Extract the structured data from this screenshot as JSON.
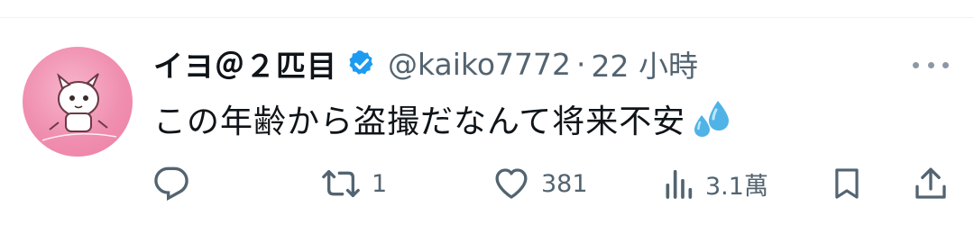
{
  "tweet": {
    "display_name": "イヨ＠２匹目",
    "handle": "@kaiko7772",
    "separator": "·",
    "time": "22 小時",
    "text": "この年齢から盗撮だなんて将来不安",
    "emoji": "sweat-droplets-icon"
  },
  "actions": {
    "reply": {
      "icon": "reply-icon"
    },
    "retweet": {
      "icon": "retweet-icon",
      "count": "1"
    },
    "like": {
      "icon": "heart-icon",
      "count": "381"
    },
    "views": {
      "icon": "views-icon",
      "count": "3.1萬"
    },
    "bookmark": {
      "icon": "bookmark-icon"
    },
    "share": {
      "icon": "share-icon"
    }
  },
  "colors": {
    "text": "#0f1419",
    "secondary": "#536471",
    "verified": "#1d9bf0",
    "avatar_bg": "#f08fb0"
  }
}
